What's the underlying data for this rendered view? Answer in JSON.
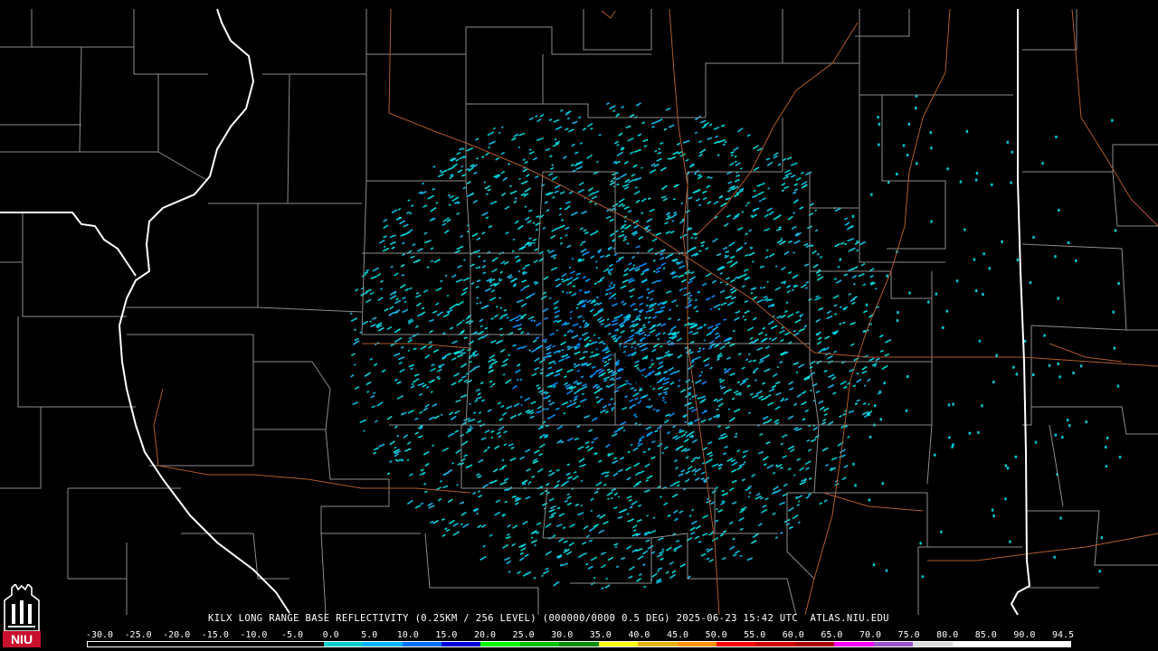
{
  "caption": {
    "station": "KILX",
    "product": "LONG RANGE BASE REFLECTIVITY",
    "resolution": "(0.25KM / 256 LEVEL)",
    "volume": "(000000/0000 0.5 DEG)",
    "timestamp": "2025-06-23 15:42 UTC",
    "source": "ATLAS.NIU.EDU"
  },
  "logo": {
    "text": "NIU",
    "icon": "niu-tower-logo",
    "color": "#c8102e"
  },
  "legend": {
    "labels": [
      "-30.0",
      "-25.0",
      "-20.0",
      "-15.0",
      "-10.0",
      "-5.0",
      "0.0",
      "5.0",
      "10.0",
      "15.0",
      "20.0",
      "25.0",
      "30.0",
      "35.0",
      "40.0",
      "45.0",
      "50.0",
      "55.0",
      "60.0",
      "65.0",
      "70.0",
      "75.0",
      "80.0",
      "85.0",
      "90.0",
      "94.5"
    ],
    "colors": [
      "#000000",
      "#000000",
      "#000000",
      "#000000",
      "#000000",
      "#000000",
      "#00cccc",
      "#00b4ff",
      "#0070ff",
      "#0000e0",
      "#00ff00",
      "#00c000",
      "#008c00",
      "#ffff00",
      "#e6b400",
      "#ff9000",
      "#ff0000",
      "#d00000",
      "#b00000",
      "#ff00ff",
      "#9955cc",
      "#dddddd",
      "#ffffff",
      "#ffffff",
      "#ffffff"
    ]
  },
  "map_layers": {
    "state_border_color": "#ffffff",
    "county_border_color": "#8c8c8c",
    "highway_color": "#b05a2a",
    "radar_site_marker": "radar-site-dot"
  }
}
